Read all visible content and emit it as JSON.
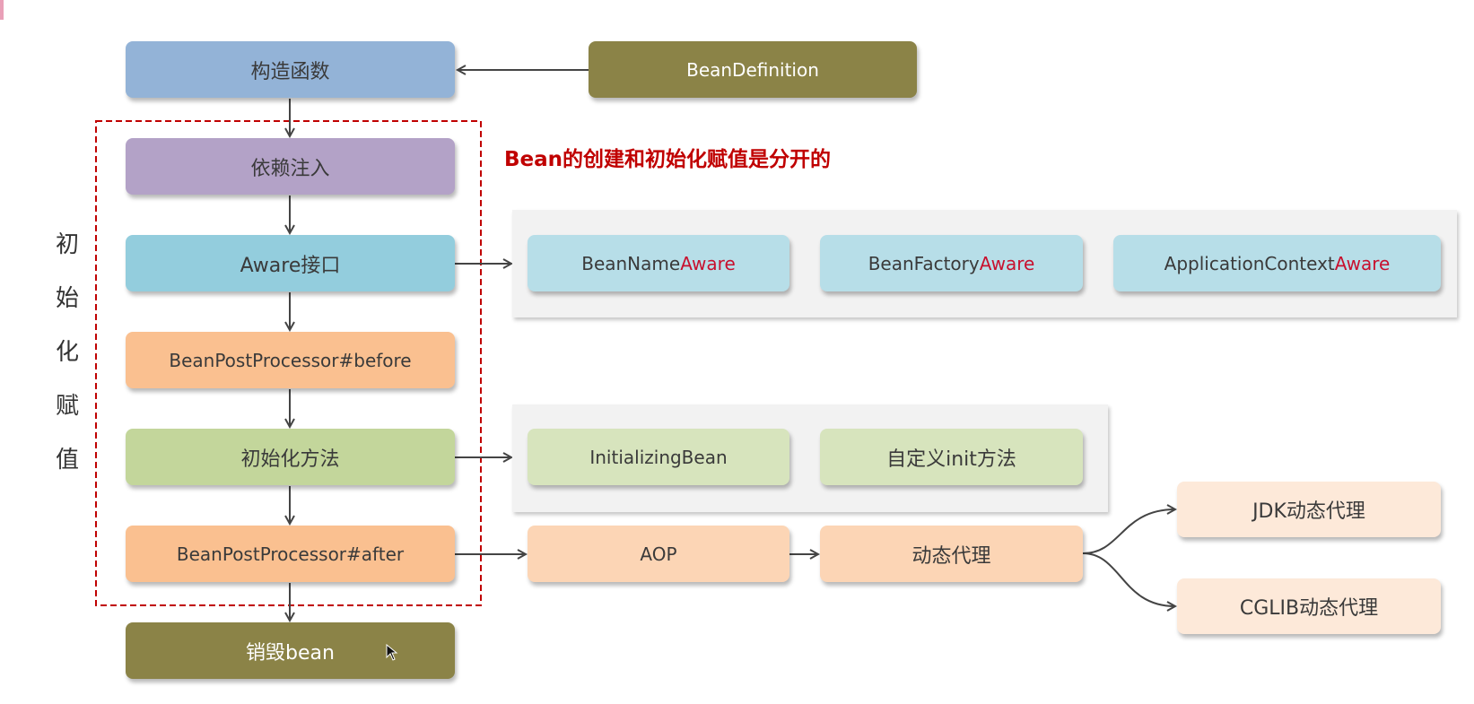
{
  "flow": {
    "constructor": "构造函数",
    "bean_definition": "BeanDefinition",
    "dependency_injection": "依赖注入",
    "aware": "Aware接口",
    "bpp_before": "BeanPostProcessor#before",
    "init_method": "初始化方法",
    "bpp_after": "BeanPostProcessor#after",
    "destroy": "销毁bean"
  },
  "side_label": [
    "初",
    "始",
    "化",
    "赋",
    "值"
  ],
  "note": "Bean的创建和初始化赋值是分开的",
  "aware_items": [
    {
      "prefix": "BeanName",
      "suffix": "Aware"
    },
    {
      "prefix": "BeanFactory",
      "suffix": "Aware"
    },
    {
      "prefix": "ApplicationContext",
      "suffix": "Aware"
    }
  ],
  "init_items": [
    "InitializingBean",
    "自定义init方法"
  ],
  "aop": {
    "aop": "AOP",
    "dynamic_proxy": "动态代理",
    "jdk": "JDK动态代理",
    "cglib": "CGLIB动态代理"
  },
  "colors": {
    "constructor": "#93b3d7",
    "olive": "#8b8347",
    "di": "#b3a2c7",
    "aware": "#93cddd",
    "bpp": "#fac090",
    "init": "#c3d69b",
    "aware_item": "#b7dee8",
    "init_item": "#d7e4bd",
    "aop": "#fcd5b5",
    "proxy_item": "#fde9d9",
    "accent": "#c00000"
  }
}
